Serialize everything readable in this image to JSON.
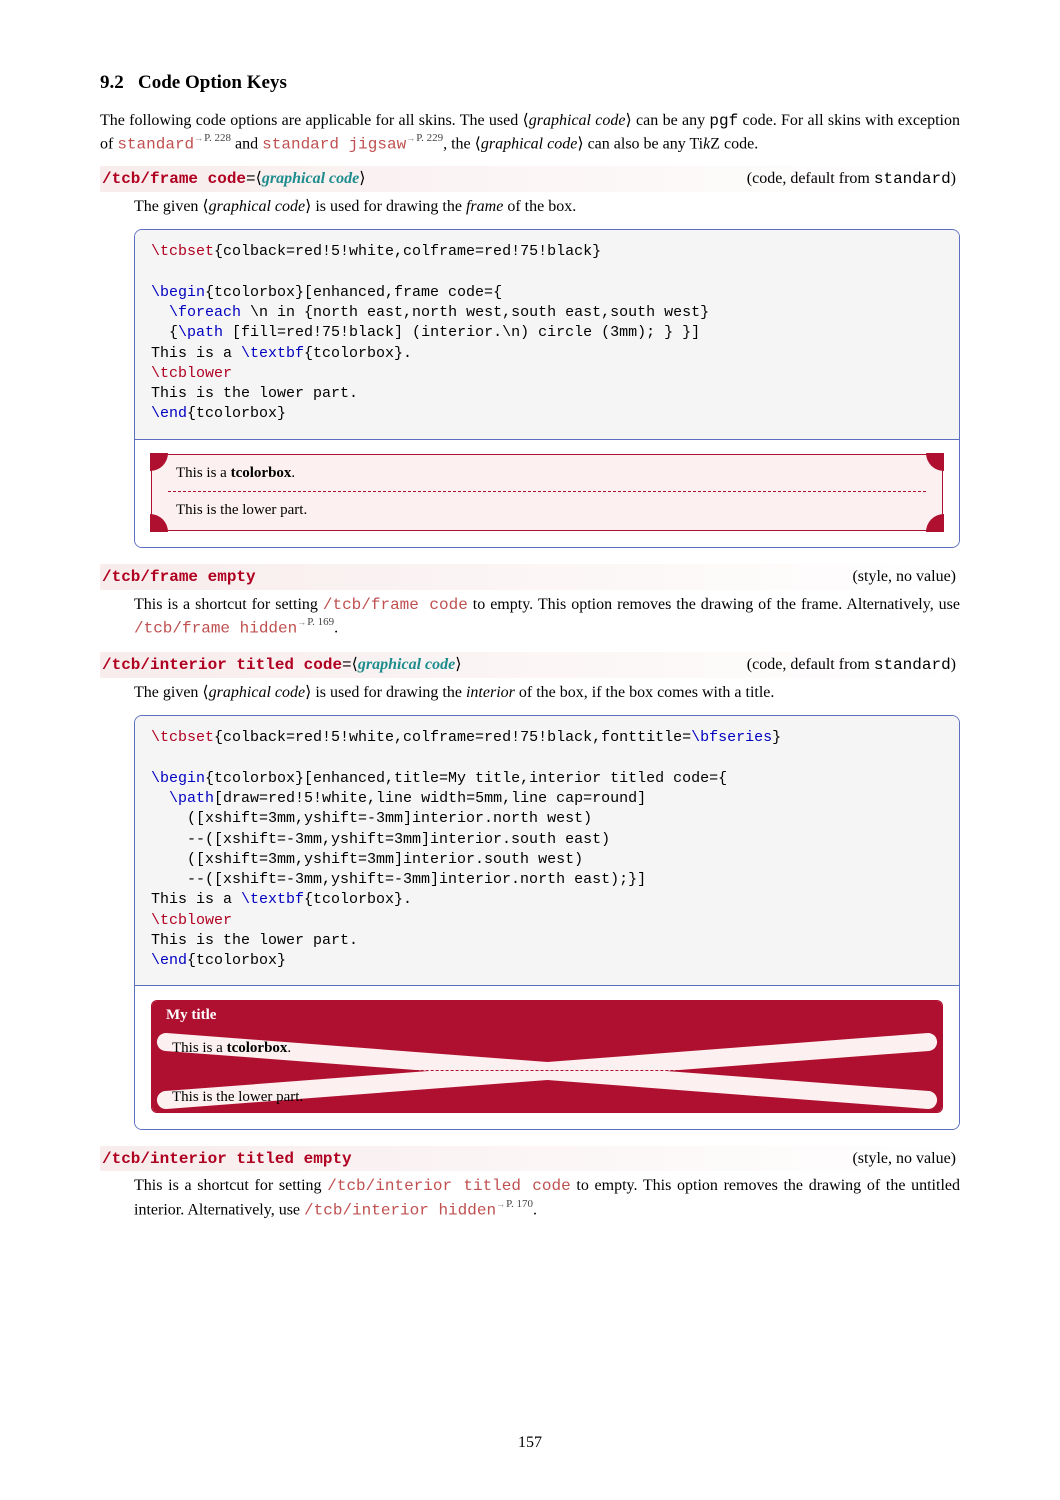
{
  "section": {
    "number": "9.2",
    "title": "Code Option Keys"
  },
  "intro": {
    "line1_a": "The following code options are applicable for all skins. The used ",
    "line1_arg": "graphical code",
    "line1_b": " can be any ",
    "line2_a": "pgf",
    "line2_b": " code.  For all skins with exception of ",
    "standard": "standard",
    "standard_ref": "P. 228",
    "line2_c": " and ",
    "jigsaw": "standard jigsaw",
    "jigsaw_ref": "P. 229",
    "line2_d": ", the ",
    "line3_arg": "graphical code",
    "line3_b": " can also be any Ti",
    "tikz_k": "k",
    "line3_c": "Z code."
  },
  "opt1": {
    "key": "/tcb/frame code",
    "eq": "=",
    "arg": "graphical code",
    "rhs_a": "(code, default from ",
    "rhs_tt": "standard",
    "rhs_b": ")",
    "desc_a": "The given ",
    "desc_arg": "graphical code",
    "desc_b": " is used for drawing the ",
    "desc_em": "frame",
    "desc_c": " of the box."
  },
  "code1": {
    "l1a": "\\tcbset",
    "l1b": "{colback=red!5!white,colframe=red!75!black}",
    "blank": "",
    "l3a": "\\begin",
    "l3b": "{tcolorbox}[enhanced,frame code={",
    "l4a": "  ",
    "l4b": "\\foreach",
    "l4c": " \\n in {north east,north west,south east,south west}",
    "l5a": "  {",
    "l5b": "\\path",
    "l5c": " [fill=red!75!black] (interior.\\n) circle (3mm); } }]",
    "l6a": "This is a ",
    "l6b": "\\textbf",
    "l6c": "{tcolorbox}.",
    "l7": "\\tcblower",
    "l8": "This is the lower part.",
    "l9a": "\\end",
    "l9b": "{tcolorbox}"
  },
  "render1": {
    "upper": "This is a ",
    "upper_bf": "tcolorbox",
    "upper_dot": ".",
    "lower": "This is the lower part."
  },
  "opt2": {
    "key": "/tcb/frame empty",
    "rhs": "(style, no value)",
    "desc_a": "This is a shortcut for setting ",
    "ref1": "/tcb/frame code",
    "desc_b": " to empty. This option removes the drawing of the frame. Alternatively, use ",
    "ref2": "/tcb/frame hidden",
    "ref2_page": "P. 169",
    "desc_c": "."
  },
  "opt3": {
    "key": "/tcb/interior titled code",
    "eq": "=",
    "arg": "graphical code",
    "rhs_a": "(code, default from ",
    "rhs_tt": "standard",
    "rhs_b": ")",
    "desc_a": "The given ",
    "desc_arg": "graphical code",
    "desc_b": " is used for drawing the ",
    "desc_em": "interior",
    "desc_c": " of the box, if the box comes with a title."
  },
  "code2": {
    "l1a": "\\tcbset",
    "l1b": "{colback=red!5!white,colframe=red!75!black,fonttitle=",
    "l1c": "\\bfseries",
    "l1d": "}",
    "l3a": "\\begin",
    "l3b": "{tcolorbox}[enhanced,title=My title,interior titled code={",
    "l4a": "  ",
    "l4b": "\\path",
    "l4c": "[draw=red!5!white,line width=5mm,line cap=round]",
    "l5": "    ([xshift=3mm,yshift=-3mm]interior.north west)",
    "l6": "    --([xshift=-3mm,yshift=3mm]interior.south east)",
    "l7": "    ([xshift=3mm,yshift=3mm]interior.south west)",
    "l8": "    --([xshift=-3mm,yshift=-3mm]interior.north east);}]",
    "l9a": "This is a ",
    "l9b": "\\textbf",
    "l9c": "{tcolorbox}.",
    "l10": "\\tcblower",
    "l11": "This is the lower part.",
    "l12a": "\\end",
    "l12b": "{tcolorbox}"
  },
  "render2": {
    "title": "My title",
    "upper": "This is a ",
    "upper_bf": "tcolorbox",
    "upper_dot": ".",
    "lower": "This is the lower part."
  },
  "opt4": {
    "key": "/tcb/interior titled empty",
    "rhs": "(style, no value)",
    "desc_a": "This is a shortcut for setting ",
    "ref1": "/tcb/interior titled code",
    "desc_b": " to empty. This option removes the drawing of the untitled interior. Alternatively, use ",
    "ref2": "/tcb/interior hidden",
    "ref2_page": "P. 170",
    "desc_c": "."
  },
  "page": "157"
}
